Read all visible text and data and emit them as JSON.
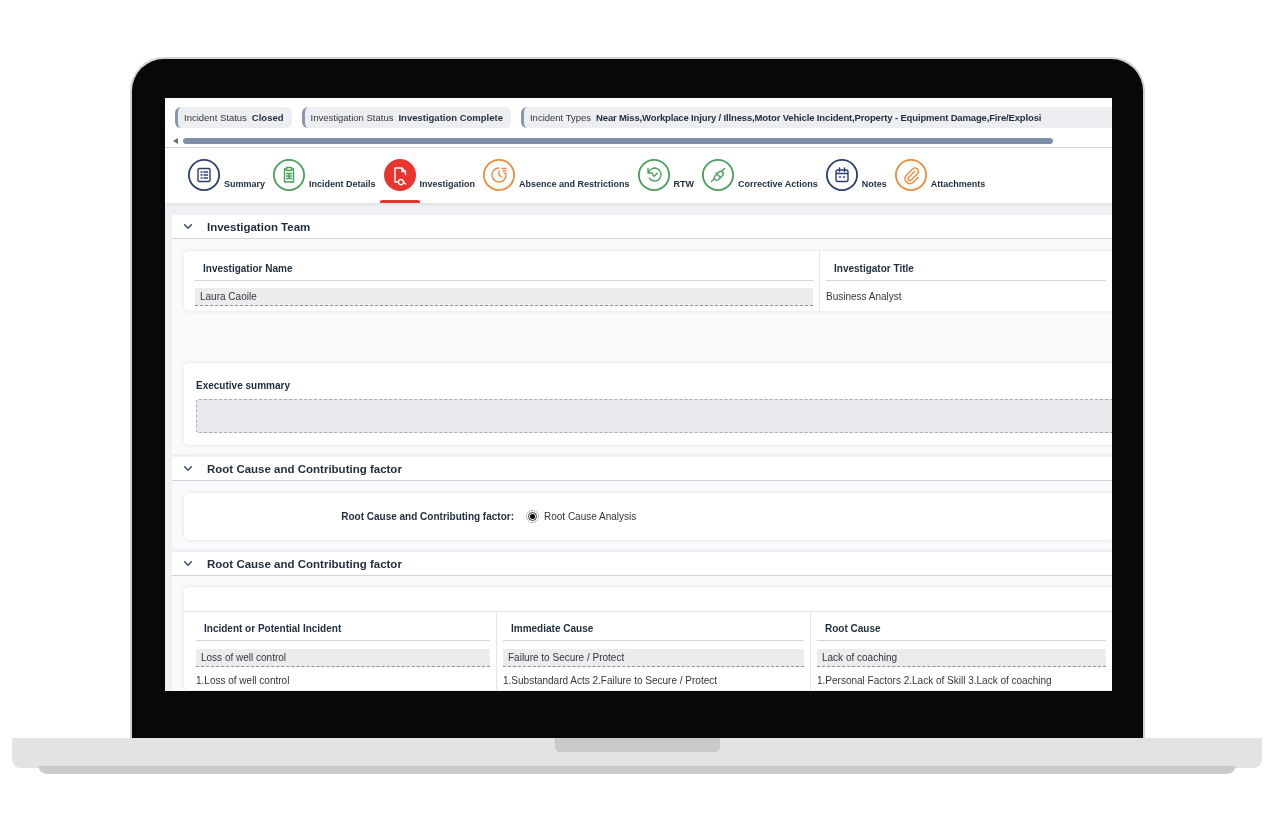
{
  "header_fields": [
    {
      "label": "Incident Status",
      "value": "Closed"
    },
    {
      "label": "Investigation Status",
      "value": "Investigation Complete"
    },
    {
      "label": "Incident Types",
      "value": "Near Miss,Workplace Injury / Illness,Motor Vehicle Incident,Property - Equipment Damage,Fire/Explosi"
    }
  ],
  "tabs": [
    {
      "label": "Summary",
      "kind": "list",
      "color": "#2d3e6e",
      "selected": false
    },
    {
      "label": "Incident Details",
      "kind": "clipboard",
      "color": "#4a9d5b",
      "selected": false
    },
    {
      "label": "Investigation",
      "kind": "search",
      "color": "#e8352f",
      "selected": true
    },
    {
      "label": "Absence and Restrictions",
      "kind": "clock",
      "color": "#ef8a3c",
      "selected": false
    },
    {
      "label": "RTW",
      "kind": "undo",
      "color": "#4a9d5b",
      "selected": false
    },
    {
      "label": "Corrective Actions",
      "kind": "plug",
      "color": "#4a9d5b",
      "selected": false
    },
    {
      "label": "Notes",
      "kind": "calendar",
      "color": "#2d3e6e",
      "selected": false
    },
    {
      "label": "Attachments",
      "kind": "paperclip",
      "color": "#ef8a3c",
      "selected": false
    }
  ],
  "sections": [
    {
      "kind": "team",
      "title": "Investigation Team",
      "expanded": true,
      "columns": [
        "Investigatior Name",
        "Investigator Title"
      ],
      "rows": [
        {
          "name": "Laura Caoile",
          "title": "Business Analyst"
        }
      ],
      "summary_label": "Executive summary"
    },
    {
      "kind": "choice",
      "title": "Root Cause and Contributing factor",
      "expanded": true,
      "field_label": "Root Cause and Contributing factor:",
      "options": [
        {
          "label": "Root Cause Analysis",
          "selected": true
        }
      ]
    },
    {
      "kind": "causes",
      "title": "Root Cause and Contributing factor",
      "expanded": true,
      "columns": [
        "Incident or Potential Incident",
        "Immediate Cause",
        "Root Cause"
      ],
      "rows": [
        {
          "cells": [
            {
              "value": "Loss of well control",
              "detail": "1.Loss of well control"
            },
            {
              "value": "Failure to Secure / Protect",
              "detail": "1.Substandard Acts 2.Failure to Secure / Protect"
            },
            {
              "value": "Lack of coaching",
              "detail": "1.Personal Factors 2.Lack of Skill 3.Lack of coaching"
            }
          ]
        }
      ]
    }
  ]
}
